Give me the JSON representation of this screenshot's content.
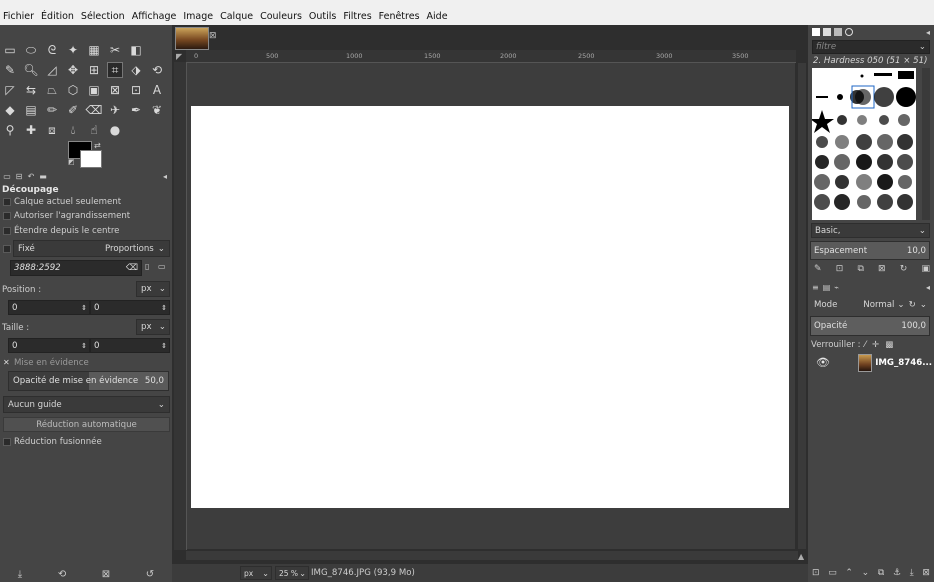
{
  "menubar": {
    "items": [
      "Fichier",
      "Édition",
      "Sélection",
      "Affichage",
      "Image",
      "Calque",
      "Couleurs",
      "Outils",
      "Filtres",
      "Fenêtres",
      "Aide"
    ]
  },
  "tool_options": {
    "title": "Découpage",
    "current_layer_only": "Calque actuel seulement",
    "allow_growing": "Autoriser l'agrandissement",
    "expand_from_center": "Étendre depuis le centre",
    "fixed_label": "Fixé",
    "fixed_mode": "Proportions",
    "ratio_value": "3888:2592",
    "position_label": "Position :",
    "position_unit": "px",
    "position_x": "0",
    "position_y": "0",
    "size_label": "Taille :",
    "size_unit": "px",
    "size_w": "0",
    "size_h": "0",
    "highlight_label": "Mise en évidence",
    "highlight_opacity_label": "Opacité de mise en évidence",
    "highlight_opacity_value": "50,0",
    "guide_option": "Aucun guide",
    "auto_shrink": "Réduction automatique",
    "shrink_merged": "Réduction fusionnée"
  },
  "ruler": {
    "ticks": [
      "0",
      "500",
      "1000",
      "1500",
      "2000",
      "2500",
      "3000",
      "3500"
    ]
  },
  "status": {
    "unit": "px",
    "zoom": "25 %",
    "file": "IMG_8746.JPG (93,9 Mo)"
  },
  "brushes": {
    "filter_placeholder": "filtre",
    "current_brush": "2. Hardness 050 (51 × 51)",
    "preset": "Basic,",
    "spacing_label": "Espacement",
    "spacing_value": "10,0"
  },
  "layers": {
    "mode_label": "Mode",
    "mode_value": "Normal",
    "opacity_label": "Opacité",
    "opacity_value": "100,0",
    "lock_label": "Verrouiller :",
    "layer_name": "IMG_8746..."
  }
}
